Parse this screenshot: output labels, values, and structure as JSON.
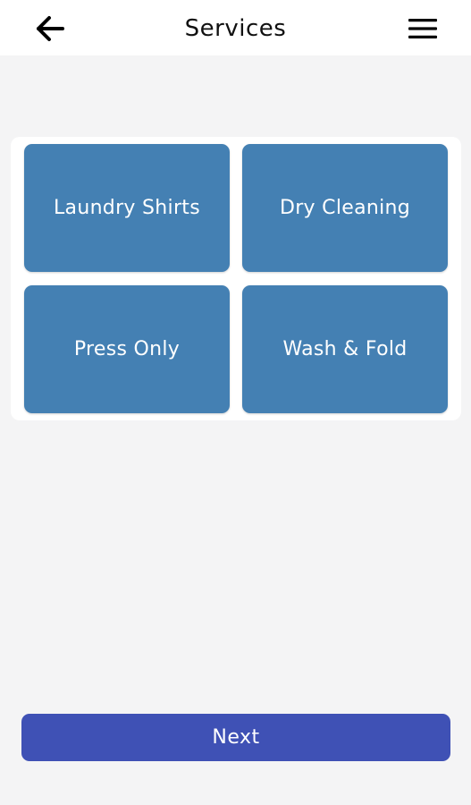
{
  "header": {
    "title": "Services",
    "back_icon": "arrow-left-icon",
    "menu_icon": "hamburger-menu-icon"
  },
  "services": [
    {
      "label": "Laundry Shirts"
    },
    {
      "label": "Dry Cleaning"
    },
    {
      "label": "Press Only"
    },
    {
      "label": "Wash & Fold"
    }
  ],
  "footer": {
    "next_label": "Next"
  },
  "colors": {
    "background": "#f4f4f5",
    "tile": "#4480b3",
    "next_button": "#3f51b5",
    "text_on_accent": "#ffffff"
  }
}
